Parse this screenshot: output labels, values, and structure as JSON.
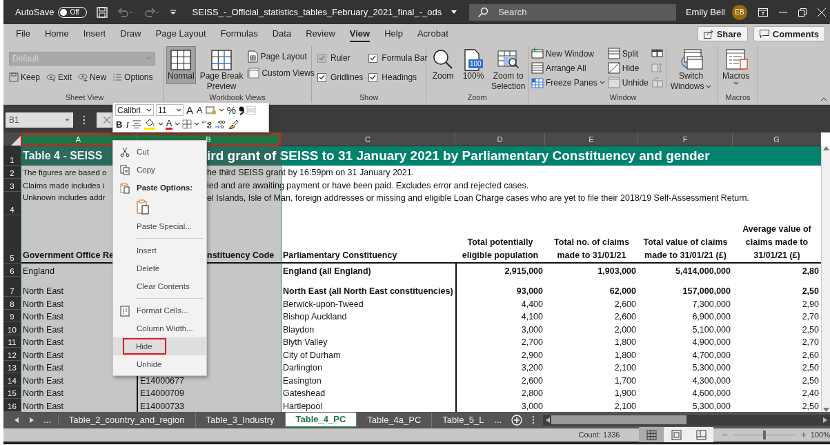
{
  "title_bar": {
    "autosave_label": "AutoSave",
    "autosave_toggle": {
      "label": "Off",
      "on": false
    },
    "file_name": "SEISS_-_Official_statistics_tables_February_2021_final_-_ods",
    "search": {
      "placeholder": "Search"
    },
    "user_name": "Emily Bell",
    "avatar_initials": "EB"
  },
  "ribbon_tabs": [
    {
      "label": "File",
      "selected": false
    },
    {
      "label": "Home",
      "selected": false
    },
    {
      "label": "Insert",
      "selected": false
    },
    {
      "label": "Draw",
      "selected": false
    },
    {
      "label": "Page Layout",
      "selected": false
    },
    {
      "label": "Formulas",
      "selected": false
    },
    {
      "label": "Data",
      "selected": false
    },
    {
      "label": "Review",
      "selected": false
    },
    {
      "label": "View",
      "selected": true
    },
    {
      "label": "Help",
      "selected": false
    },
    {
      "label": "Acrobat",
      "selected": false
    }
  ],
  "ribbon_actions": [
    "Share",
    "Comments"
  ],
  "ribbon_groups": [
    {
      "kind": "sheet_view",
      "label": "Sheet View",
      "dropdown": {
        "value": "Default",
        "disabled": true
      },
      "buttons": [
        "Keep",
        "Exit",
        "New",
        "Options"
      ]
    },
    {
      "kind": "workbook_views",
      "label": "Workbook Views",
      "large_buttons": [
        {
          "label": "Normal",
          "selected": true
        },
        {
          "label": "Page Break Preview",
          "selected": false
        }
      ],
      "small_buttons": [
        "Page Layout",
        "Custom Views"
      ]
    },
    {
      "kind": "show",
      "label": "Show",
      "checkboxes": [
        {
          "label": "Ruler",
          "checked": true,
          "disabled": true
        },
        {
          "label": "Formula Bar",
          "checked": true,
          "disabled": false
        },
        {
          "label": "Gridlines",
          "checked": true,
          "disabled": false
        },
        {
          "label": "Headings",
          "checked": true,
          "disabled": false
        }
      ]
    },
    {
      "kind": "zoom",
      "label": "Zoom",
      "buttons": [
        {
          "label": "Zoom"
        },
        {
          "label": "100%",
          "icon_text": "100"
        },
        {
          "label": "Zoom to Selection"
        }
      ]
    },
    {
      "kind": "window",
      "label": "Window",
      "small_buttons": [
        {
          "label": "New Window",
          "dropdown": false
        },
        {
          "label": "Arrange All",
          "dropdown": false
        },
        {
          "label": "Freeze Panes",
          "dropdown": true
        },
        {
          "label": "Split",
          "dropdown": false
        },
        {
          "label": "Hide",
          "dropdown": false
        },
        {
          "label": "Unhide",
          "dropdown": false
        }
      ],
      "icon_buttons": [
        {
          "disabled": false
        },
        {
          "disabled": true
        },
        {
          "disabled": true
        }
      ],
      "large_button": {
        "label": "Switch Windows",
        "dropdown": true
      }
    },
    {
      "kind": "macros",
      "label": "Macros",
      "large_button": {
        "label": "Macros",
        "dropdown": true
      }
    }
  ],
  "formula_bar": {
    "name_box": "B1"
  },
  "mini_toolbar": {
    "font": "Calibri",
    "size": "11",
    "row1_glyphs": [
      "A",
      "A",
      "%"
    ],
    "row2_glyphs": [
      "B",
      "I",
      "A"
    ]
  },
  "context_menu": [
    {
      "kind": "cut",
      "label": "Cut",
      "selected": false
    },
    {
      "kind": "copy",
      "label": "Copy",
      "selected": false
    },
    {
      "kind": "paste_heading",
      "label": "Paste Options:",
      "selected": false
    },
    {
      "kind": "paste_option",
      "selected": false
    },
    {
      "kind": "plain",
      "label": "Paste Special...",
      "selected": false
    },
    {
      "kind": "separator"
    },
    {
      "kind": "plain",
      "label": "Insert",
      "selected": false
    },
    {
      "kind": "plain",
      "label": "Delete",
      "selected": false
    },
    {
      "kind": "plain",
      "label": "Clear Contents",
      "selected": false
    },
    {
      "kind": "separator"
    },
    {
      "kind": "format_cells",
      "label": "Format Cells...",
      "selected": false
    },
    {
      "kind": "plain",
      "label": "Column Width...",
      "selected": false
    },
    {
      "kind": "plain",
      "label": "Hide",
      "selected": true
    },
    {
      "kind": "plain",
      "label": "Unhide",
      "selected": false
    }
  ],
  "sheet": {
    "columns": [
      {
        "label": "A",
        "selected": true
      },
      {
        "label": "B",
        "selected": true
      },
      {
        "label": "C",
        "selected": false
      },
      {
        "label": "D",
        "selected": false
      },
      {
        "label": "E",
        "selected": false
      },
      {
        "label": "F",
        "selected": false
      },
      {
        "label": "G",
        "selected": false
      }
    ],
    "note_rows": [
      {
        "row": "1",
        "kind": "title",
        "left": "Table 4 - SEISS",
        "right": "ird grant of SEISS to 31 January 2021 by Parliamentary Constituency and gender"
      },
      {
        "row": "2",
        "kind": "note",
        "left": "The figures are based o",
        "right": "he third SEISS grant by 16:59pm on 31 January 2021."
      },
      {
        "row": "3",
        "kind": "note",
        "left": "Claims made includes i",
        "right": "ied and are awaiting payment or have been paid. Excludes error and rejected cases."
      },
      {
        "row": "4",
        "kind": "note_tall",
        "left": "Unknown includes addr",
        "right": "el Islands, Isle of Man, foreign addresses or missing and eligible Loan Charge cases who are yet to file their 2018/19 Self-Assessment Return."
      }
    ],
    "header_row": {
      "row": "5",
      "cells": [
        "Government Office Re",
        "nstituency Code",
        "Parliamentary Constituency",
        "Total potentially eligible population",
        "Total no. of claims made to 31/01/21",
        "Total value of claims made to 31/01/21 (£)",
        "Average value of claims made to 31/01/21 (£)"
      ]
    },
    "rows": [
      {
        "row": "6",
        "kind": "country",
        "cells": [
          "England",
          "",
          "England (all England)",
          "2,915,000",
          "1,903,000",
          "5,414,000,000",
          "2,80"
        ]
      },
      {
        "row": "7",
        "kind": "region",
        "cells": [
          "North East",
          "",
          "North East (all North East constituencies)",
          "93,000",
          "62,000",
          "157,000,000",
          "2,50"
        ]
      },
      {
        "row": "8",
        "kind": "constituency",
        "cells": [
          "North East",
          "",
          "Berwick-upon-Tweed",
          "4,400",
          "2,600",
          "7,300,000",
          "2,90"
        ]
      },
      {
        "row": "9",
        "kind": "constituency",
        "cells": [
          "North East",
          "",
          "Bishop Auckland",
          "4,100",
          "2,600",
          "6,900,000",
          "2,70"
        ]
      },
      {
        "row": "10",
        "kind": "constituency",
        "cells": [
          "North East",
          "",
          "Blaydon",
          "3,000",
          "2,000",
          "5,100,000",
          "2,50"
        ]
      },
      {
        "row": "11",
        "kind": "constituency",
        "cells": [
          "North East",
          "",
          "Blyth Valley",
          "2,700",
          "1,800",
          "4,900,000",
          "2,70"
        ]
      },
      {
        "row": "12",
        "kind": "constituency",
        "cells": [
          "North East",
          "",
          "City of Durham",
          "2,900",
          "1,800",
          "4,700,000",
          "2,60"
        ]
      },
      {
        "row": "13",
        "kind": "constituency",
        "cells": [
          "North East",
          "",
          "Darlington",
          "3,200",
          "2,100",
          "5,300,000",
          "2,50"
        ]
      },
      {
        "row": "14",
        "kind": "constituency",
        "cells": [
          "North East",
          "E14000677",
          "Easington",
          "2,600",
          "1,700",
          "4,300,000",
          "2,50"
        ]
      },
      {
        "row": "15",
        "kind": "constituency",
        "cells": [
          "North East",
          "E14000709",
          "Gateshead",
          "2,800",
          "1,900",
          "4,600,000",
          "2,40"
        ]
      },
      {
        "row": "16",
        "kind": "constituency",
        "cells": [
          "North East",
          "E14000733",
          "Hartlepool",
          "3,000",
          "2,100",
          "5,300,000",
          "2,50"
        ]
      }
    ]
  },
  "sheet_tabs": {
    "more_left": "...",
    "tabs": [
      {
        "label": "Table_2_country_and_region",
        "selected": false
      },
      {
        "label": "Table_3_Industry",
        "selected": false
      },
      {
        "label": "Table_4_PC",
        "selected": true
      },
      {
        "label": "Table_4a_PC",
        "selected": false
      },
      {
        "label": "Table_5_L",
        "selected": false
      }
    ],
    "more_right": "..."
  },
  "status_bar": {
    "count": "Count: 1336",
    "views": [
      {
        "selected": true
      },
      {
        "selected": false
      },
      {
        "selected": false
      }
    ],
    "zoom_minus": "−",
    "zoom_plus": "+",
    "zoom": {
      "level": 0.5
    },
    "zoom_label": "100%"
  }
}
